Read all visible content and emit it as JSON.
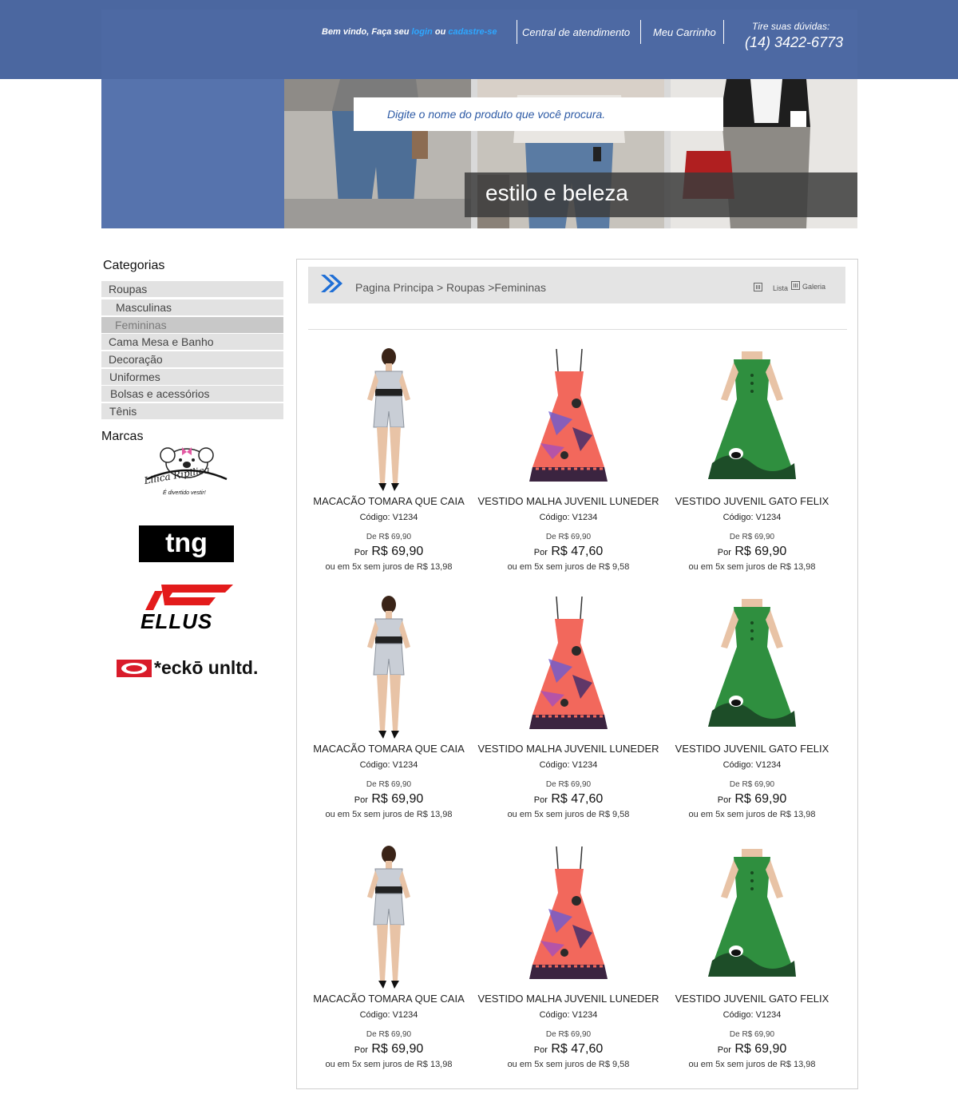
{
  "header": {
    "welcome_prefix": "Bem vindo, Faça seu",
    "login_label": "login",
    "or_label": "ou",
    "register_label": "cadastre-se",
    "support_label": "Central de atendimento",
    "cart_label": "Meu Carrinho",
    "phone_label": "Tire suas dúvidas:",
    "phone": "(14) 3422-6773"
  },
  "search": {
    "placeholder": "Digite o nome do produto que você procura."
  },
  "banner": {
    "slogan": "estilo e beleza"
  },
  "sidebar": {
    "categories_title": "Categorias",
    "categories": [
      {
        "label": "Roupas"
      },
      {
        "label": "Masculinas"
      },
      {
        "label": "Femininas"
      },
      {
        "label": "Cama Mesa e Banho"
      },
      {
        "label": "Decoração"
      },
      {
        "label": "Uniformes"
      },
      {
        "label": "Bolsas e acessórios"
      },
      {
        "label": "Tênis"
      }
    ],
    "brands_title": "Marcas",
    "brands": [
      {
        "name": "Lilica Ripilica",
        "tagline": "É divertido vestir!",
        "icon": "koala-logo"
      },
      {
        "name": "tng"
      },
      {
        "name": "ELLUS"
      },
      {
        "name": "*eckō unltd."
      }
    ]
  },
  "breadcrumb": {
    "home": "Pagina Principa",
    "sep": ">",
    "level1": "Roupas",
    "level2": "Femininas",
    "view_list": "Lista",
    "view_gallery": "Galeria"
  },
  "products": [
    {
      "name": "MACACÃO TOMARA QUE CAIA",
      "code": "Código: V1234",
      "old_price": "De R$ 69,90",
      "por": "Por",
      "price": "R$ 69,90",
      "installments": "ou em 5x sem juros de R$ 13,98",
      "kind": "romper"
    },
    {
      "name": "VESTIDO MALHA JUVENIL LUNEDER",
      "code": "Código: V1234",
      "old_price": "De R$ 69,90",
      "por": "Por",
      "price": "R$ 47,60",
      "installments": "ou em 5x sem juros de R$ 9,58",
      "kind": "pink-dress"
    },
    {
      "name": "VESTIDO JUVENIL GATO FELIX",
      "code": "Código: V1234",
      "old_price": "De R$ 69,90",
      "por": "Por",
      "price": "R$ 69,90",
      "installments": "ou em 5x sem juros de R$ 13,98",
      "kind": "green-dress"
    },
    {
      "name": "MACACÃO TOMARA QUE CAIA",
      "code": "Código: V1234",
      "old_price": "De R$ 69,90",
      "por": "Por",
      "price": "R$ 69,90",
      "installments": "ou em 5x sem juros de R$ 13,98",
      "kind": "romper"
    },
    {
      "name": "VESTIDO MALHA JUVENIL LUNEDER",
      "code": "Código: V1234",
      "old_price": "De R$ 69,90",
      "por": "Por",
      "price": "R$ 47,60",
      "installments": "ou em 5x sem juros de R$ 9,58",
      "kind": "pink-dress"
    },
    {
      "name": "VESTIDO JUVENIL GATO FELIX",
      "code": "Código: V1234",
      "old_price": "De R$ 69,90",
      "por": "Por",
      "price": "R$ 69,90",
      "installments": "ou em 5x sem juros de R$ 13,98",
      "kind": "green-dress"
    },
    {
      "name": "MACACÃO TOMARA QUE CAIA",
      "code": "Código: V1234",
      "old_price": "De R$ 69,90",
      "por": "Por",
      "price": "R$ 69,90",
      "installments": "ou em 5x sem juros de R$ 13,98",
      "kind": "romper"
    },
    {
      "name": "VESTIDO MALHA JUVENIL LUNEDER",
      "code": "Código: V1234",
      "old_price": "De R$ 69,90",
      "por": "Por",
      "price": "R$ 47,60",
      "installments": "ou em 5x sem juros de R$ 9,58",
      "kind": "pink-dress"
    },
    {
      "name": "VESTIDO JUVENIL GATO FELIX",
      "code": "Código: V1234",
      "old_price": "De R$ 69,90",
      "por": "Por",
      "price": "R$ 69,90",
      "installments": "ou em 5x sem juros de R$ 13,98",
      "kind": "green-dress"
    }
  ],
  "colors": {
    "header_blue": "#4d69a3",
    "link_blue": "#2ea7ff",
    "arrow_blue": "#1f6fd6"
  }
}
